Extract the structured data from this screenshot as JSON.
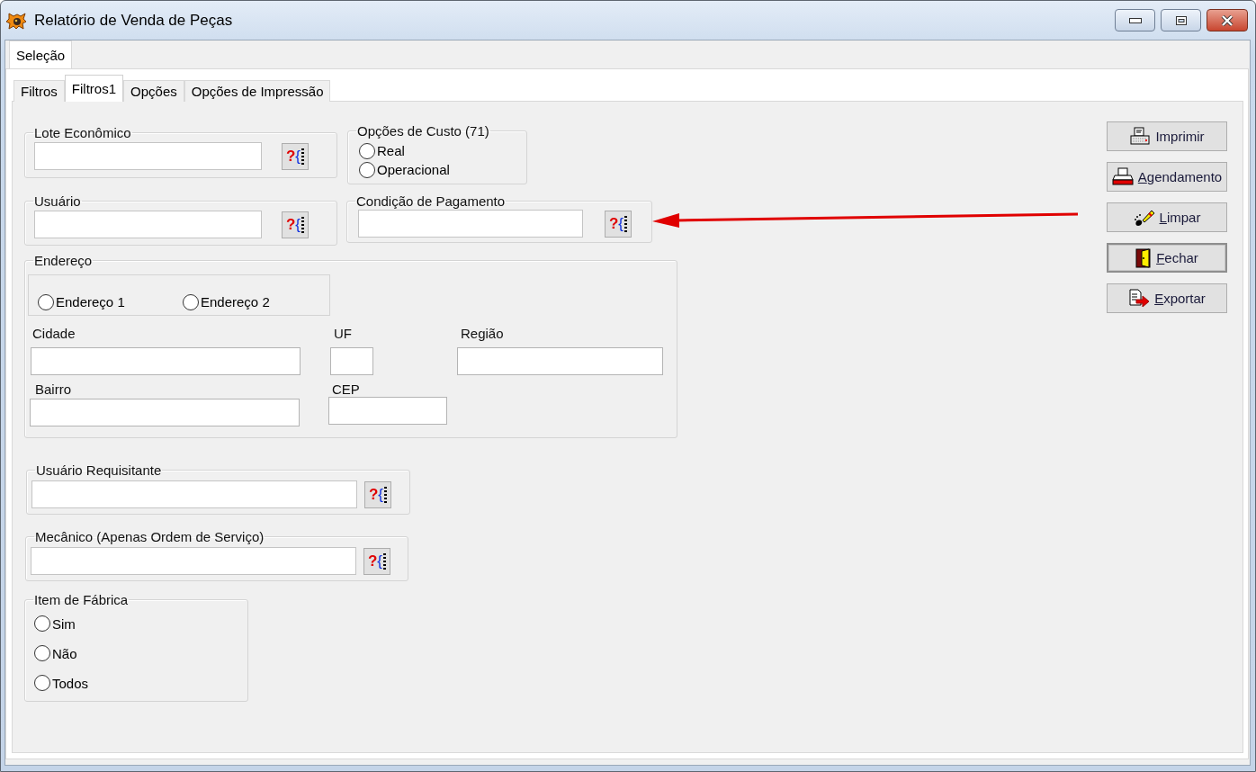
{
  "window": {
    "title": "Relatório de Venda de Peças"
  },
  "outer_tabs": [
    {
      "label": "Seleção",
      "selected": true
    }
  ],
  "tabs": [
    {
      "label": "Filtros",
      "selected": false
    },
    {
      "label": "Filtros1",
      "selected": true
    },
    {
      "label": "Opções",
      "selected": false
    },
    {
      "label": "Opções de Impressão",
      "selected": false
    }
  ],
  "lote_economico": {
    "label": "Lote Econômico",
    "lookup_button": "?{"
  },
  "opcoes_custo": {
    "label": "Opções de Custo (71)",
    "options": [
      {
        "label": "Real",
        "checked": false
      },
      {
        "label": "Operacional",
        "checked": false
      }
    ]
  },
  "usuario": {
    "label": "Usuário",
    "lookup_button": "?{"
  },
  "condicao_pagamento": {
    "label": "Condição de Pagamento",
    "lookup_button": "?{"
  },
  "endereco": {
    "label": "Endereço",
    "options": [
      {
        "label": "Endereço 1",
        "checked": false
      },
      {
        "label": "Endereço 2",
        "checked": false
      }
    ],
    "fields": [
      {
        "label": "Cidade"
      },
      {
        "label": "UF"
      },
      {
        "label": "Região"
      },
      {
        "label": "Bairro"
      },
      {
        "label": "CEP"
      }
    ]
  },
  "usuario_requisitante": {
    "label": "Usuário Requisitante",
    "lookup_button": "?{"
  },
  "mecanico": {
    "label": "Mecânico (Apenas Ordem de Serviço)",
    "lookup_button": "?{"
  },
  "item_de_fabrica": {
    "label": "Item de Fábrica",
    "options": [
      {
        "label": "Sim",
        "checked": false
      },
      {
        "label": "Não",
        "checked": false
      },
      {
        "label": "Todos",
        "checked": false
      }
    ]
  },
  "actions": [
    {
      "label": "Imprimir",
      "kind": "print",
      "mnemonic": false,
      "focused": false
    },
    {
      "label": "Agendamento",
      "kind": "schedule",
      "mnemonic": true,
      "focused": false
    },
    {
      "label": "Limpar",
      "kind": "clear",
      "mnemonic": true,
      "focused": false
    },
    {
      "label": "Fechar",
      "kind": "close",
      "mnemonic": true,
      "focused": true
    },
    {
      "label": "Exportar",
      "kind": "export",
      "mnemonic": true,
      "focused": false
    }
  ]
}
